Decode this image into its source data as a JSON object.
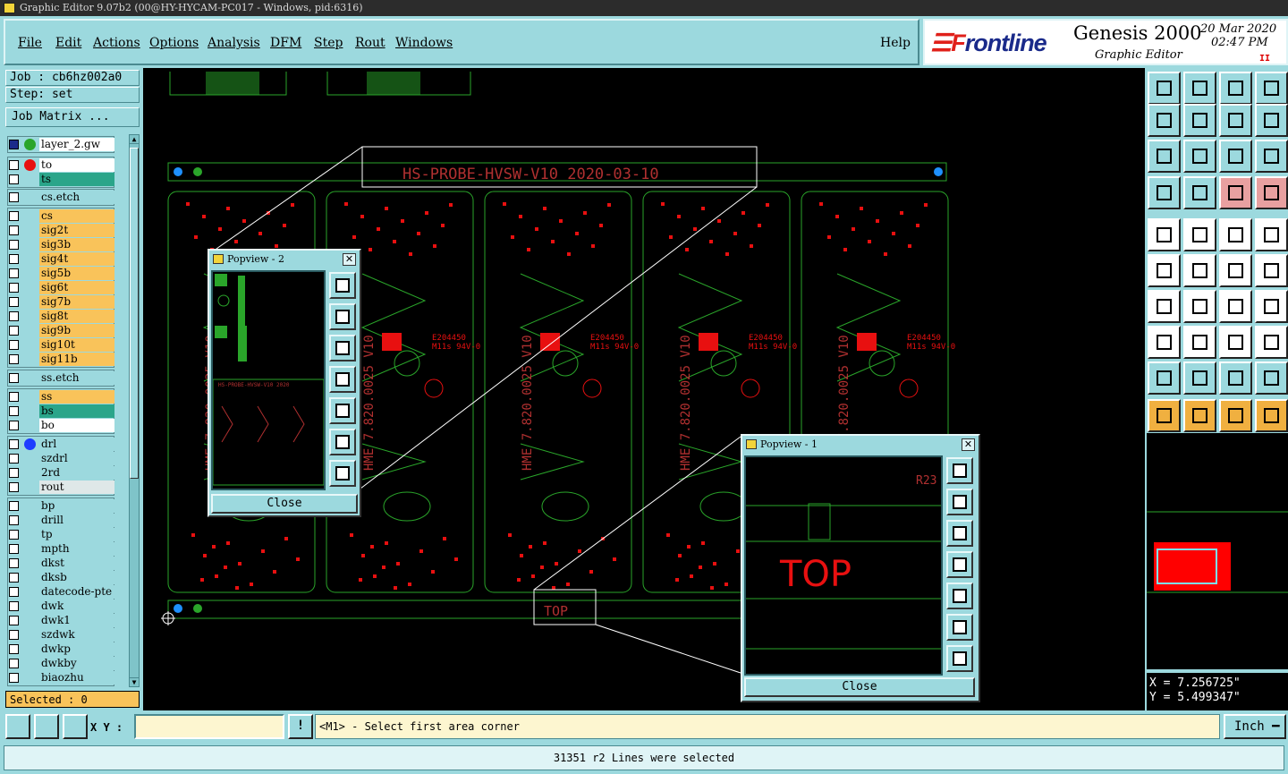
{
  "window_title": "Graphic Editor 9.07b2 (00@HY-HYCAM-PC017 - Windows, pid:6316)",
  "menu": {
    "file": "File",
    "edit": "Edit",
    "actions": "Actions",
    "options": "Options",
    "analysis": "Analysis",
    "dfm": "DFM",
    "step": "Step",
    "rout": "Rout",
    "windows": "Windows",
    "help": "Help"
  },
  "brand": {
    "logo_pre": "☰F",
    "logo_main": "rontline",
    "product": "Genesis 2000",
    "subtitle": "Graphic Editor",
    "date": "20 Mar 2020",
    "time": "02:47 PM",
    "pause": "II"
  },
  "job": {
    "job_label": "Job : cb6hz002a0",
    "step_label": "Step: set",
    "matrix_button": "Job Matrix ..."
  },
  "layers": {
    "top": [
      {
        "name": "layer_2.gw",
        "bg": "#ffffff",
        "dot": "#2aa52a"
      }
    ],
    "g1": [
      {
        "name": "to",
        "bg": "#ffffff",
        "dot": "#e81010"
      },
      {
        "name": "ts",
        "bg": "#2aa58a",
        "dot": ""
      }
    ],
    "g2": [
      {
        "name": "cs.etch",
        "bg": "#9cd9de",
        "dot": ""
      }
    ],
    "g3": [
      {
        "name": "cs"
      },
      {
        "name": "sig2t"
      },
      {
        "name": "sig3b"
      },
      {
        "name": "sig4t"
      },
      {
        "name": "sig5b"
      },
      {
        "name": "sig6t"
      },
      {
        "name": "sig7b"
      },
      {
        "name": "sig8t"
      },
      {
        "name": "sig9b"
      },
      {
        "name": "sig10t"
      },
      {
        "name": "sig11b"
      }
    ],
    "g4": [
      {
        "name": "ss.etch"
      }
    ],
    "g5": [
      {
        "name": "ss",
        "bg": "#f9c35a"
      },
      {
        "name": "bs",
        "bg": "#2aa58a"
      },
      {
        "name": "bo",
        "bg": "#ffffff"
      }
    ],
    "g6": [
      {
        "name": "drl"
      },
      {
        "name": "szdrl"
      },
      {
        "name": "2rd"
      },
      {
        "name": "rout"
      }
    ],
    "g7": [
      {
        "name": "bp"
      },
      {
        "name": "drill"
      },
      {
        "name": "tp"
      },
      {
        "name": "mpth"
      },
      {
        "name": "dkst"
      },
      {
        "name": "dksb"
      },
      {
        "name": "datecode-pte"
      },
      {
        "name": "dwk"
      },
      {
        "name": "dwk1"
      },
      {
        "name": "szdwk"
      },
      {
        "name": "dwkp"
      },
      {
        "name": "dwkby"
      },
      {
        "name": "biaozhu"
      }
    ]
  },
  "selected": "Selected : 0",
  "board": {
    "header_text": "HS-PROBE-HVSW-V10 2020-03-10",
    "panel_label": "HME 7.820.0025 V10",
    "ul_text": "E204450",
    "rating_text": "M11s 94V-0",
    "top_text": "TOP",
    "ref_text": "R23"
  },
  "popview2": {
    "title": "Popview - 2",
    "close": "Close"
  },
  "popview1": {
    "title": "Popview - 1",
    "close": "Close"
  },
  "coords": {
    "x": "X =  7.256725\"",
    "y": "Y =  5.499347\""
  },
  "bottom": {
    "xy_label": "X Y :",
    "xy_value": "",
    "prompt": "<M1> - Select first area corner",
    "unit": "Inch ━"
  },
  "status": "31351 r2 Lines were selected"
}
